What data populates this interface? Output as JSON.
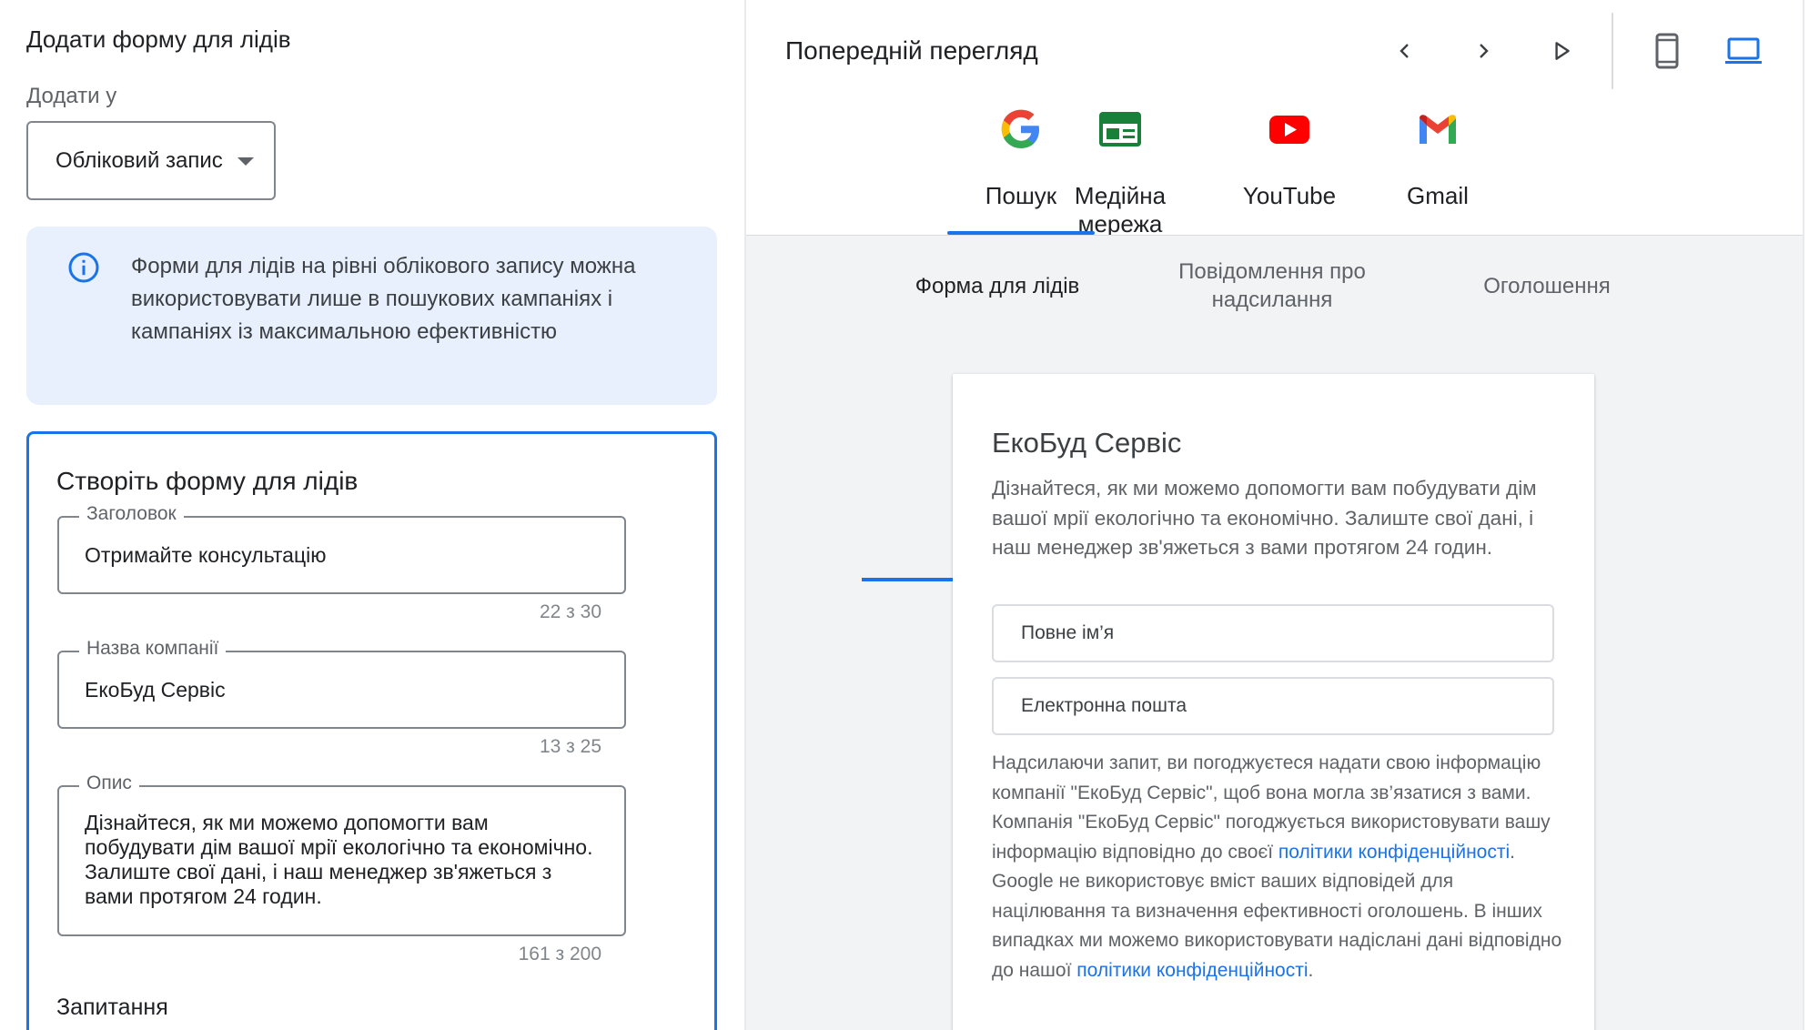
{
  "left": {
    "page_title": "Додати форму для лідів",
    "add_to_label": "Додати у",
    "account_select": "Обліковий запис",
    "info_text": "Форми для лідів на рівні облікового запису можна використовувати лише в пошукових кампаніях і кампаніях із максимальною ефективністю",
    "create_title": "Створіть форму для лідів",
    "fields": [
      {
        "label": "Заголовок",
        "value": "Отримайте консультацію",
        "counter": "22 з 30"
      },
      {
        "label": "Назва компанії",
        "value": "ЕкоБуд Сервіс",
        "counter": "13 з 25"
      },
      {
        "label": "Опис",
        "value": "Дізнайтеся, як ми можемо допомогти вам побудувати дім вашої мрії екологічно та економічно. Залиште свої дані, і наш менеджер зв'яжеться з вами протягом 24 годин.",
        "counter": "161 з 200"
      }
    ],
    "questions_title": "Запитання"
  },
  "right": {
    "preview_title": "Попередній перегляд",
    "channels": [
      {
        "label": "Пошук",
        "icon": "google-icon"
      },
      {
        "label": "Медійна мережа",
        "icon": "display-network-icon"
      },
      {
        "label": "YouTube",
        "icon": "youtube-icon"
      },
      {
        "label": "Gmail",
        "icon": "gmail-icon"
      }
    ],
    "selected_channel": "Пошук",
    "subtabs": [
      {
        "label": "Форма для лідів"
      },
      {
        "label": "Повідомлення про надсилання"
      },
      {
        "label": "Оголошення"
      }
    ],
    "selected_subtab": "Форма для лідів",
    "device_selected": "desktop",
    "form": {
      "title": "ЕкоБуд Сервіс",
      "description": "Дізнайтеся, як ми можемо допомогти вам побудувати дім вашої мрії екологічно та економічно. Залиште свої дані, і наш менеджер зв'яжеться з вами протягом 24 годин.",
      "fields": [
        {
          "placeholder": "Повне ім’я"
        },
        {
          "placeholder": "Електронна пошта"
        }
      ],
      "consent_part1": "Надсилаючи запит, ви погоджуєтеся надати свою інформацію компанії \"ЕкоБуд Сервіс\", щоб вона могла зв’язатися з вами. Компанія \"ЕкоБуд Сервіс\" погоджується використовувати вашу інформацію відповідно до своєї ",
      "consent_link1": "політики конфіденційності",
      "consent_part2": ". Google не використовує вміст ваших відповідей для націлювання та визначення ефективності оголошень. В інших випадках ми можемо використовувати надіслані дані відповідно до нашої ",
      "consent_link2": "політики конфіденційності",
      "consent_part3": "."
    }
  },
  "colors": {
    "accent": "#1a73e8",
    "info_bg": "#e8f0fe",
    "preview_bg": "#f1f3f4"
  }
}
